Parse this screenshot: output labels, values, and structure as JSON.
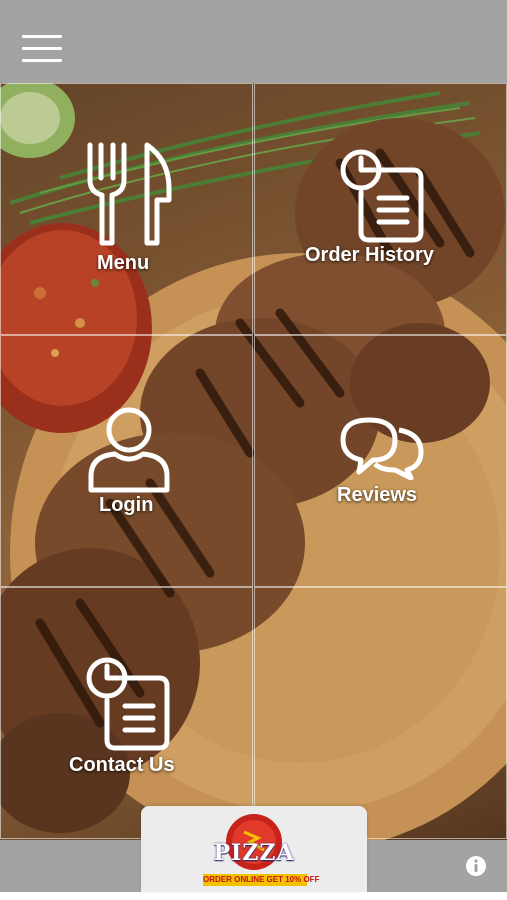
{
  "header": {
    "menu_icon": "hamburger-menu-icon"
  },
  "tiles": [
    {
      "label": "Menu",
      "icon": "fork-knife-icon"
    },
    {
      "label": "Order History",
      "icon": "clock-document-icon"
    },
    {
      "label": "Login",
      "icon": "user-icon"
    },
    {
      "label": "Reviews",
      "icon": "speech-bubbles-icon"
    },
    {
      "label": "Contact Us",
      "icon": "clock-document-icon"
    }
  ],
  "banner": {
    "brand": "PIZZA",
    "promo": "ORDER ONLINE GET 10% OFF"
  },
  "footer": {
    "info_icon": "info-icon"
  },
  "colors": {
    "bar": "#a3a3a3",
    "label": "#ffffff",
    "promo_bg": "#f2c200",
    "promo_text": "#c41212"
  }
}
